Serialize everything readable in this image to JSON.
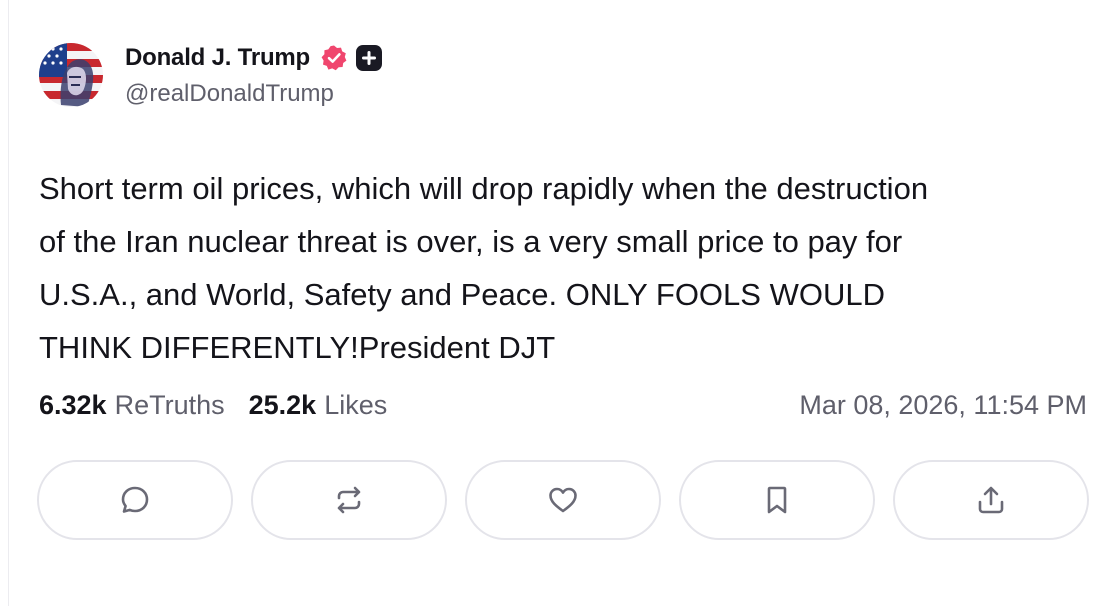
{
  "author": {
    "display_name": "Donald J. Trump",
    "handle": "@realDonaldTrump",
    "verified_color": "#f0466e",
    "badge_icon": "plus-icon"
  },
  "post": {
    "text": "Short term oil prices, which will drop rapidly when the destruction\nof the Iran nuclear threat is over, is a very small price to pay for\nU.S.A., and World, Safety and Peace. ONLY FOOLS WOULD\nTHINK DIFFERENTLY!President DJT"
  },
  "stats": {
    "retruths_count": "6.32k",
    "retruths_label": "ReTruths",
    "likes_count": "25.2k",
    "likes_label": "Likes",
    "timestamp": "Mar 08, 2026, 11:54 PM"
  },
  "actions": [
    {
      "name": "reply",
      "icon": "comment-icon"
    },
    {
      "name": "retruth",
      "icon": "repost-icon"
    },
    {
      "name": "like",
      "icon": "heart-icon"
    },
    {
      "name": "bookmark",
      "icon": "bookmark-icon"
    },
    {
      "name": "share",
      "icon": "share-icon"
    }
  ],
  "colors": {
    "text": "#14141a",
    "muted": "#5f5f6b",
    "border": "#e4e4ea"
  }
}
